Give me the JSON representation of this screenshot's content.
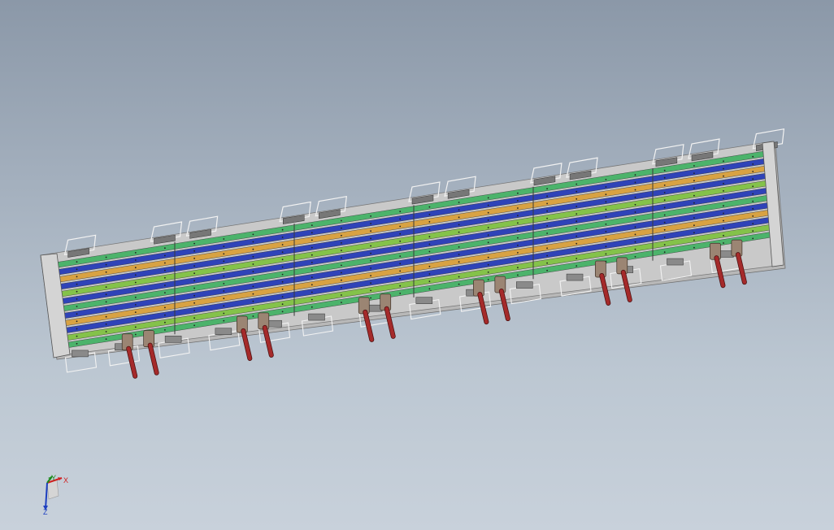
{
  "viewport": {
    "background_top": "#8b98a8",
    "background_bottom": "#c8d1db"
  },
  "model": {
    "frame_color": "#c9c9c9",
    "rail_colors": [
      "#4cb36b",
      "#2f43b8",
      "#d8a243",
      "#84c24a"
    ],
    "clamp_handle_color": "#a52a2a",
    "clamp_body_color": "#9b8573",
    "bracket_color": "#dcdcdc",
    "segments": 6,
    "rails": 12
  },
  "triad": {
    "x_label": "X",
    "y_label": "Y",
    "z_label": "Z",
    "x_color": "#d02020",
    "y_color": "#1a8a1a",
    "z_color": "#1d3fc0"
  }
}
